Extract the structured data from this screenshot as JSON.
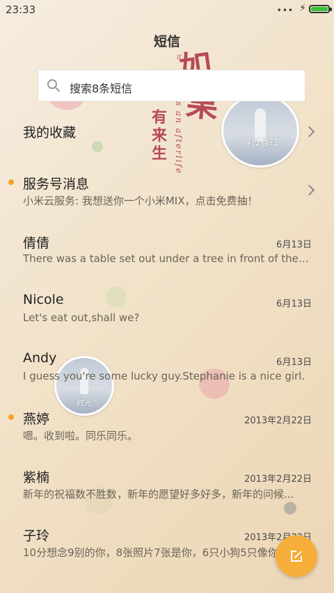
{
  "status_bar": {
    "time": "23:33",
    "signal_dots": "•••"
  },
  "header": {
    "title": "短信"
  },
  "search": {
    "placeholder": "搜索8条短信"
  },
  "decoration": {
    "calligraphy_top": "如",
    "calligraphy_bottom": "果",
    "vertical_text": "有来生",
    "script_text": "is an afterlife",
    "small_script": "If",
    "photo_caption_top": "得过且过",
    "photo_caption_mid": "时光"
  },
  "favorites": {
    "label": "我的收藏"
  },
  "service": {
    "label": "服务号消息",
    "preview": "小米云服务: 我想送你一个小米MIX，点击免费抽！"
  },
  "threads": [
    {
      "name": "倩倩",
      "date": "6月13日",
      "preview": "There was a table set out under a tree in front of the ho...",
      "unread": false
    },
    {
      "name": "Nicole",
      "date": "6月13日",
      "preview": "Let's eat out,shall we?",
      "unread": false
    },
    {
      "name": "Andy",
      "date": "6月13日",
      "preview": "I guess you're some lucky guy.Stephanie is a nice girl.",
      "unread": false
    },
    {
      "name": "燕婷",
      "date": "2013年2月22日",
      "preview": "嗯。收到啦。同乐同乐。",
      "unread": true
    },
    {
      "name": "紫楠",
      "date": "2013年2月22日",
      "preview": "新年的祝福数不胜数，新年的愿望好多好多，新年的问候...",
      "unread": false
    },
    {
      "name": "子玲",
      "date": "2013年2月22日",
      "preview": "10分想念9别的你，8张照片7张是你，6只小狗5只像你...",
      "unread": false
    }
  ],
  "colors": {
    "accent": "#f6ad39",
    "unread_dot": "#f5a423",
    "battery": "#37c13a",
    "calligraphy": "#b64a5a"
  },
  "fab": {
    "icon": "compose-icon"
  }
}
